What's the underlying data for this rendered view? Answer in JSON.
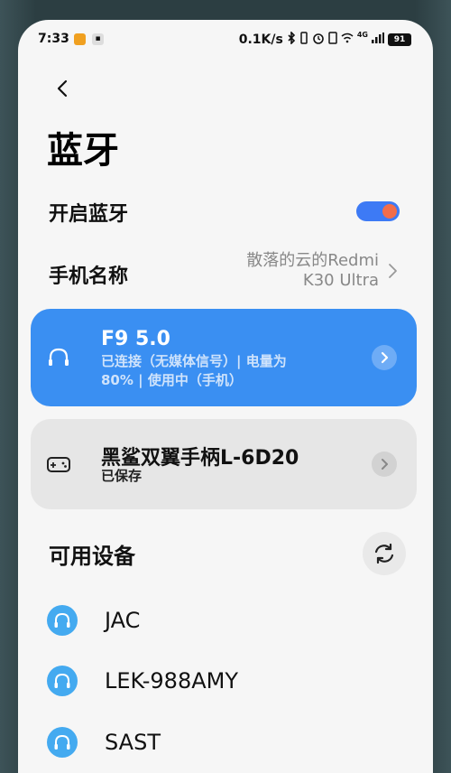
{
  "status_bar": {
    "time": "7:33",
    "network_speed": "0.1K/s",
    "network_type": "4G",
    "battery": "91"
  },
  "page": {
    "title": "蓝牙"
  },
  "bluetooth_toggle": {
    "label": "开启蓝牙",
    "enabled": true
  },
  "device_name": {
    "label": "手机名称",
    "value_line1": "散落的云的Redmi",
    "value_line2": "K30 Ultra"
  },
  "paired_devices": [
    {
      "name": "F9 5.0",
      "status_line1": "已连接（无媒体信号）| 电量为",
      "status_line2": "80% | 使用中（手机）",
      "icon": "headphones-icon",
      "active": true
    },
    {
      "name": "黑鲨双翼手柄L-6D20",
      "status_line1": "已保存",
      "icon": "gamepad-icon",
      "active": false
    }
  ],
  "available": {
    "title": "可用设备",
    "items": [
      {
        "label": "JAC",
        "icon": "headphones-icon"
      },
      {
        "label": "LEK-988AMY",
        "icon": "headphones-icon"
      },
      {
        "label": "SAST",
        "icon": "headphones-icon"
      }
    ]
  },
  "colors": {
    "accent": "#3a8ff2",
    "toggle_on": "#3d7af5",
    "device_icon": "#44aaf0"
  }
}
